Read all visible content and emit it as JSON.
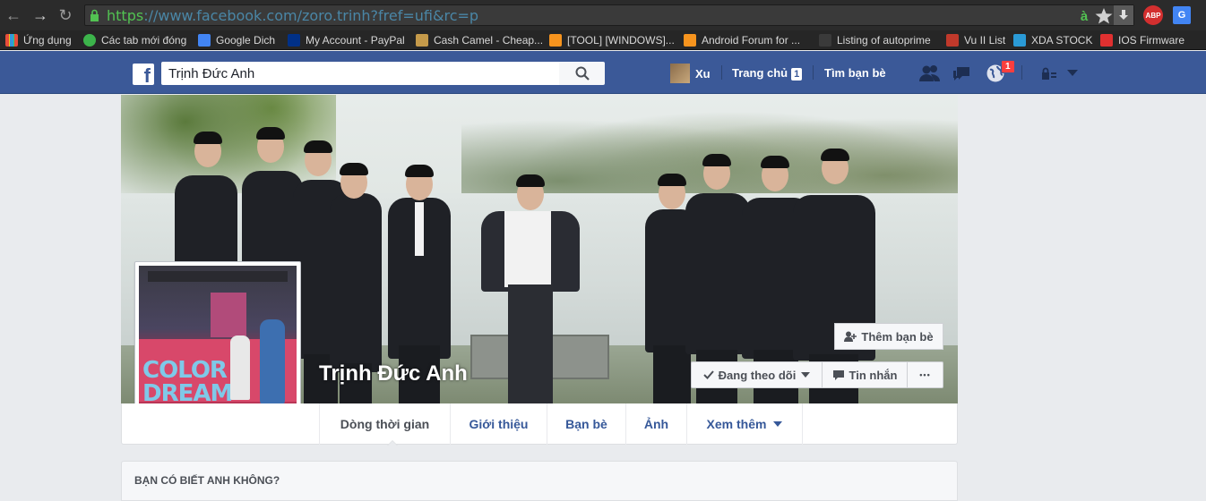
{
  "browser": {
    "url_scheme": "https",
    "url_rest": "://www.facebook.com/zoro.trinh?fref=ufi&rc=p",
    "extension_labels": [
      "ABP"
    ]
  },
  "bookmarks": [
    {
      "label": "Ứng dụng",
      "icon": "apps-grid-icon",
      "color": "#e74c3c"
    },
    {
      "label": "Các tab mới đóng",
      "icon": "history-icon",
      "color": "#3cb44b"
    },
    {
      "label": "Google Dich",
      "icon": "google-translate-icon",
      "color": "#4285f4"
    },
    {
      "label": "My Account - PayPal",
      "icon": "paypal-icon",
      "color": "#003087"
    },
    {
      "label": "Cash Camel - Cheap...",
      "icon": "camel-icon",
      "color": "#c59a4a"
    },
    {
      "label": "[TOOL] [WINDOWS]...",
      "icon": "xda-icon",
      "color": "#f7941e"
    },
    {
      "label": "Android Forum for ...",
      "icon": "xda-icon",
      "color": "#f7941e"
    },
    {
      "label": "Listing of autoprime",
      "icon": "page-icon",
      "color": "#3a3a3a"
    },
    {
      "label": "Vu II List",
      "icon": "list-icon",
      "color": "#c0392b"
    },
    {
      "label": "XDA STOCK",
      "icon": "sc-icon",
      "color": "#2a9ad6"
    },
    {
      "label": "IOS Firmware",
      "icon": "hi-icon",
      "color": "#e03030"
    }
  ],
  "fb_bar": {
    "search_value": "Trịnh Đức Anh",
    "user_name": "Xu",
    "home_label": "Trang chủ",
    "home_count": "1",
    "find_friends_label": "Tìm bạn bè",
    "notification_count": "1"
  },
  "profile": {
    "name": "Trịnh Đức Anh",
    "pic_text_1": "COLOR",
    "pic_text_2": "DREAM",
    "add_friend_label": "Thêm bạn bè",
    "following_label": "Đang theo dõi",
    "message_label": "Tin nhắn",
    "more_label": "•••"
  },
  "timeline_tabs": [
    {
      "label": "Dòng thời gian",
      "active": true
    },
    {
      "label": "Giới thiệu",
      "active": false
    },
    {
      "label": "Bạn bè",
      "active": false
    },
    {
      "label": "Ảnh",
      "active": false
    },
    {
      "label": "Xem thêm",
      "active": false
    }
  ],
  "card": {
    "title": "BẠN CÓ BIẾT ANH KHÔNG?"
  },
  "colors": {
    "fb_blue": "#3b5998",
    "link_blue": "#365899",
    "notif_red": "#fa3e3e"
  }
}
